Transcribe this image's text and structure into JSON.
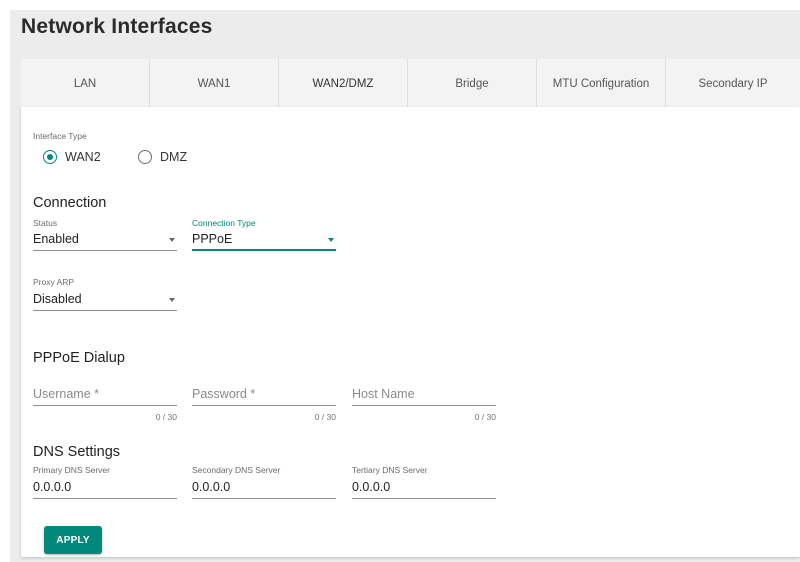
{
  "page_title": "Network Interfaces",
  "tabs": [
    {
      "label": "LAN"
    },
    {
      "label": "WAN1"
    },
    {
      "label": "WAN2/DMZ",
      "active": true
    },
    {
      "label": "Bridge"
    },
    {
      "label": "MTU Configuration"
    },
    {
      "label": "Secondary IP"
    }
  ],
  "interface_type": {
    "caption": "Interface Type",
    "options": [
      "WAN2",
      "DMZ"
    ],
    "selected": "WAN2"
  },
  "connection": {
    "title": "Connection",
    "status": {
      "caption": "Status",
      "value": "Enabled"
    },
    "connection_type": {
      "caption": "Connection Type",
      "value": "PPPoE"
    },
    "proxy_arp": {
      "caption": "Proxy ARP",
      "value": "Disabled"
    }
  },
  "pppoe": {
    "title": "PPPoE Dialup",
    "username": {
      "placeholder": "Username *",
      "counter": "0 / 30"
    },
    "password": {
      "placeholder": "Password *",
      "counter": "0 / 30"
    },
    "host_name": {
      "placeholder": "Host Name",
      "counter": "0 / 30"
    }
  },
  "dns": {
    "title": "DNS Settings",
    "primary": {
      "caption": "Primary DNS Server",
      "value": "0.0.0.0"
    },
    "secondary": {
      "caption": "Secondary DNS Server",
      "value": "0.0.0.0"
    },
    "tertiary": {
      "caption": "Tertiary DNS Server",
      "value": "0.0.0.0"
    }
  },
  "apply_label": "APPLY",
  "colors": {
    "accent": "#00897b"
  }
}
